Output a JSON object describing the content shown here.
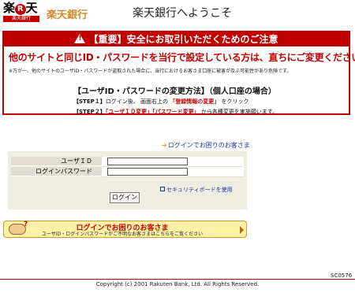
{
  "header": {
    "logo_main_left": "楽",
    "logo_r": "R",
    "logo_main_right": "天",
    "logo_sub": "楽天銀行",
    "brand_name": "楽天銀行",
    "welcome": "楽天銀行へようこそ"
  },
  "warning": {
    "icon_mark": "!",
    "title": "【重要】安全にお取引いただくためのご注意",
    "main": "他のサイトと同じID・パスワードを当行で設定している方は、直ちにご変更ください。",
    "note": "※万が一、他のサイトのユーザID・パスワードが盗取された場合に、当行におけるお客さま口座に被害が及ぶ可能性があり危険です。",
    "procedure_title": "【ユーザID・パスワードの変更方法】（個人口座の場合）",
    "step1_label": "【STEP１】",
    "step1_text_a": "ログイン後、 画面右上の",
    "step1_highlight": "「登録情報の変更」",
    "step1_text_b": "をクリック",
    "step2_label": "【STEP２】",
    "step2_highlight_a": "「ユーザＩＤ変更」",
    "step2_highlight_b": "「パスワード変更」",
    "step2_text": "から各種変更を実施願います。"
  },
  "help_link": {
    "arrow": "➔",
    "label": "ログインでお困りのお客さま"
  },
  "login_form": {
    "userid_label": "ユーザＩＤ",
    "userid_value": "",
    "password_label": "ログインパスワード",
    "password_value": "",
    "security_keyboard_label": "セキュリティボードを使用",
    "login_button": "ログイン"
  },
  "trouble_banner": {
    "question_mark": "?",
    "title": "ログインでお困りのお客さま",
    "subtitle": "ユーザID・ログインパスワードがご不明なお客さまはこちらをご覧ください"
  },
  "footer": {
    "page_code": "SC0576",
    "copyright": "Copyright (c) 2001 Rakuten Bank, Ltd. All Rights Reserved."
  },
  "colors": {
    "brand_red": "#c00000",
    "brand_orange": "#d18a2a",
    "link_blue": "#1a3a9a",
    "banner_yellow": "#fff0a8"
  }
}
